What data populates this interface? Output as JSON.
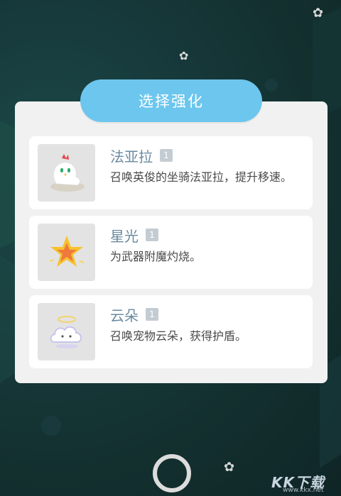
{
  "colors": {
    "accent": "#6cc6ee",
    "panel": "#f1f1f1",
    "card": "#ffffff",
    "name_text": "#6a8aa0",
    "level_badge": "#c4ccd3"
  },
  "dialog": {
    "title": "选择强化",
    "options": [
      {
        "icon": "chicken-mount-icon",
        "name": "法亚拉",
        "level": "1",
        "description": "召唤英俊的坐骑法亚拉，提升移速。"
      },
      {
        "icon": "star-icon",
        "name": "星光",
        "level": "1",
        "description": "为武器附魔灼烧。"
      },
      {
        "icon": "cloud-pet-icon",
        "name": "云朵",
        "level": "1",
        "description": "召唤宠物云朵，获得护盾。"
      }
    ]
  },
  "watermark": {
    "text": "KK下载",
    "url": "www.kkx.net"
  }
}
